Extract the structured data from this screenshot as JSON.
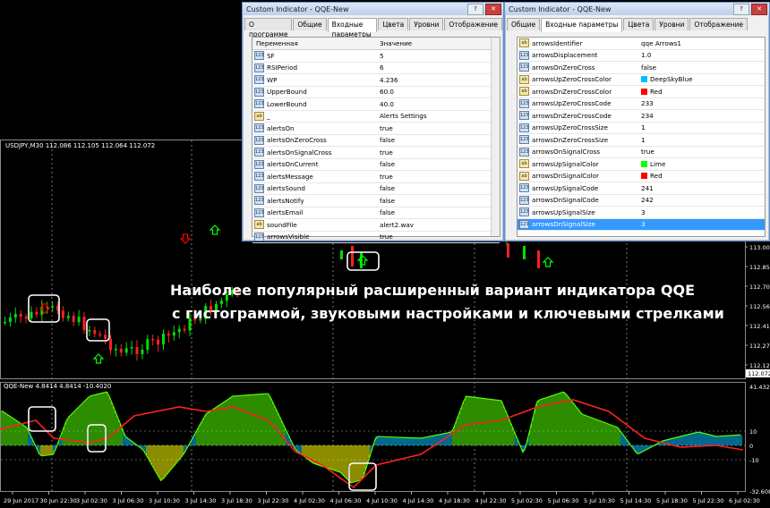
{
  "chart": {
    "symbol_header": "USDJPY,M30  112.086 112.105 112.064 112.072",
    "indicator_header": "QQE-New  4.8414 4.8414 -10.4020",
    "price_scale": [
      "113.000",
      "112.855",
      "112.705",
      "112.560",
      "112.415",
      "112.270",
      "112.125",
      "112.072"
    ],
    "indicator_scale": [
      "41.4326",
      "10",
      "0",
      "-10",
      "-32.6083"
    ],
    "time_axis": [
      "29 Jun 2017",
      "30 Jun 22:30",
      "3 Jul 02:30",
      "3 Jul 06:30",
      "3 Jul 10:30",
      "3 Jul 14:30",
      "3 Jul 18:30",
      "3 Jul 22:30",
      "4 Jul 02:30",
      "4 Jul 06:30",
      "4 Jul 10:30",
      "4 Jul 14:30",
      "4 Jul 18:30",
      "4 Jul 22:30",
      "5 Jul 02:30",
      "5 Jul 06:30",
      "5 Jul 10:30",
      "5 Jul 14:30",
      "5 Jul 18:30",
      "5 Jul 22:30",
      "6 Jul 02:30"
    ],
    "colors": {
      "bull": "#00e000",
      "bear": "#ff2020",
      "up_arrow": "#00ff00",
      "down_arrow": "#ff0000",
      "rsi_line": "#ff2020",
      "hist_bull": "#55ff00",
      "hist_zero": "#00bfff",
      "hist_bear": "#ffff00",
      "highlight": "#ffffff"
    }
  },
  "promo": {
    "line1": "Наиболее популярный расширенный вариант индикатора QQE",
    "line2": "с гистограммой, звуковыми настройками и ключевыми стрелками"
  },
  "dialog_left": {
    "title": "Custom Indicator - QQE-New",
    "tabs": [
      "О программе",
      "Общие",
      "Входные параметры",
      "Цвета",
      "Уровни",
      "Отображение"
    ],
    "active_tab": "Входные параметры",
    "col_variable": "Переменная",
    "col_value": "Значение",
    "rows": [
      {
        "icon": "123",
        "name": "SF",
        "value": "5"
      },
      {
        "icon": "123",
        "name": "RSIPeriod",
        "value": "6"
      },
      {
        "icon": "123",
        "name": "WP",
        "value": "4.236"
      },
      {
        "icon": "123",
        "name": "UpperBound",
        "value": "60.0"
      },
      {
        "icon": "123",
        "name": "LowerBound",
        "value": "40.0"
      },
      {
        "icon": "ab",
        "name": "_",
        "value": "Alerts Settings"
      },
      {
        "icon": "123",
        "name": "alertsOn",
        "value": "true"
      },
      {
        "icon": "123",
        "name": "alertsOnZeroCross",
        "value": "false"
      },
      {
        "icon": "123",
        "name": "alertsOnSignalCross",
        "value": "true"
      },
      {
        "icon": "123",
        "name": "alertsOnCurrent",
        "value": "false"
      },
      {
        "icon": "123",
        "name": "alertsMessage",
        "value": "true"
      },
      {
        "icon": "123",
        "name": "alertsSound",
        "value": "false"
      },
      {
        "icon": "123",
        "name": "alertsNotify",
        "value": "false"
      },
      {
        "icon": "123",
        "name": "alertsEmail",
        "value": "false"
      },
      {
        "icon": "ab",
        "name": "soundFile",
        "value": "alert2.wav"
      },
      {
        "icon": "123",
        "name": "arrowsVisible",
        "value": "true"
      }
    ]
  },
  "dialog_right": {
    "title": "Custom Indicator - QQE-New",
    "tabs": [
      "Общие",
      "Входные параметры",
      "Цвета",
      "Уровни",
      "Отображение"
    ],
    "active_tab": "Входные параметры",
    "rows": [
      {
        "icon": "ab",
        "name": "arrowsIdentifier",
        "value": "qqe Arrows1",
        "color": ""
      },
      {
        "icon": "123",
        "name": "arrowsDisplacement",
        "value": "1.0",
        "color": ""
      },
      {
        "icon": "123",
        "name": "arrowsOnZeroCross",
        "value": "false",
        "color": ""
      },
      {
        "icon": "ab",
        "name": "arrowsUpZeroCrossColor",
        "value": "DeepSkyBlue",
        "color": "#00bfff"
      },
      {
        "icon": "ab",
        "name": "arrowsDnZeroCrossColor",
        "value": "Red",
        "color": "#ff0000"
      },
      {
        "icon": "123",
        "name": "arrowsUpZeroCrossCode",
        "value": "233",
        "color": ""
      },
      {
        "icon": "123",
        "name": "arrowsDnZeroCrossCode",
        "value": "234",
        "color": ""
      },
      {
        "icon": "123",
        "name": "arrowsUpZeroCrossSize",
        "value": "1",
        "color": ""
      },
      {
        "icon": "123",
        "name": "arrowsDnZeroCrossSize",
        "value": "1",
        "color": ""
      },
      {
        "icon": "123",
        "name": "arrowsOnSignalCross",
        "value": "true",
        "color": ""
      },
      {
        "icon": "ab",
        "name": "arrowsUpSignalColor",
        "value": "Lime",
        "color": "#00ff00"
      },
      {
        "icon": "ab",
        "name": "arrowsDnSignalColor",
        "value": "Red",
        "color": "#ff0000"
      },
      {
        "icon": "123",
        "name": "arrowsUpSignalCode",
        "value": "241",
        "color": ""
      },
      {
        "icon": "123",
        "name": "arrowsDnSignalCode",
        "value": "242",
        "color": ""
      },
      {
        "icon": "123",
        "name": "arrowsUpSignalSize",
        "value": "3",
        "color": ""
      },
      {
        "icon": "123",
        "name": "arrowsDnSignalSize",
        "value": "3",
        "color": ""
      }
    ],
    "selected_row": "arrowsDnSignalSize"
  }
}
